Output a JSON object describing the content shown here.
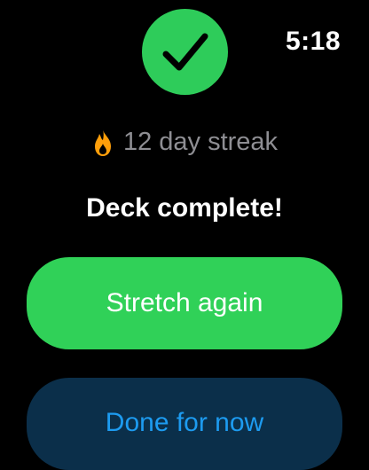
{
  "status": {
    "time": "5:18"
  },
  "header": {
    "icon": "checkmark-icon",
    "accent": "#30d158"
  },
  "streak": {
    "icon": "flame-icon",
    "text": "12 day streak"
  },
  "title": "Deck complete!",
  "actions": {
    "primary_label": "Stretch again",
    "secondary_label": "Done for now"
  },
  "colors": {
    "primary": "#30d158",
    "secondary_bg": "#0b2f4a",
    "secondary_text": "#1d9bf0",
    "flame": "#ff9f0a"
  }
}
